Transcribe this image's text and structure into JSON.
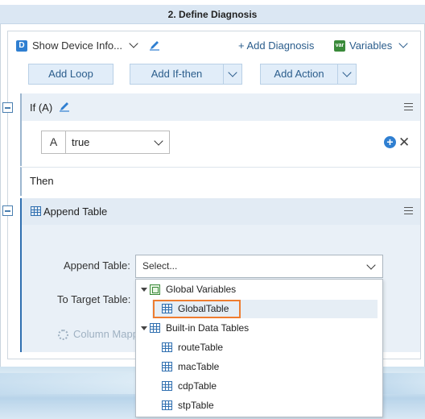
{
  "header": {
    "title": "2. Define Diagnosis"
  },
  "toolbar": {
    "device_badge": "D",
    "device_label": "Show Device Info...",
    "add_diagnosis": "+ Add Diagnosis",
    "variables_badge": "var",
    "variables_label": "Variables"
  },
  "buttons": {
    "add_loop": "Add Loop",
    "add_if_then": "Add If-then",
    "add_action": "Add Action"
  },
  "if_block": {
    "label": "If (A)",
    "condition_letter": "A",
    "condition_value": "true"
  },
  "then_block": {
    "label": "Then"
  },
  "append_block": {
    "label": "Append Table",
    "append_table_label": "Append Table:",
    "append_table_placeholder": "Select...",
    "target_table_label": "To Target Table:",
    "column_mapping_label": "Column Mapp"
  },
  "dropdown": {
    "groups": [
      {
        "label": "Global Variables",
        "icon": "global-variable-icon",
        "items": [
          {
            "label": "GlobalTable",
            "selected": true
          }
        ]
      },
      {
        "label": "Built-in Data Tables",
        "icon": "table-icon",
        "items": [
          {
            "label": "routeTable"
          },
          {
            "label": "macTable"
          },
          {
            "label": "cdpTable"
          },
          {
            "label": "stpTable"
          }
        ]
      }
    ]
  },
  "colors": {
    "accent": "#2f7fd1",
    "highlight_border": "#ee7d30",
    "header_bg": "#dbe7f3",
    "block_bg": "#e9f0f7"
  }
}
